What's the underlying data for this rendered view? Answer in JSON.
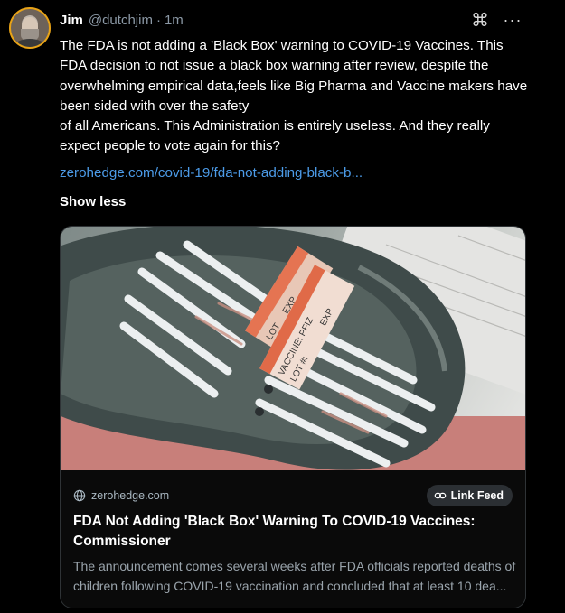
{
  "post": {
    "author_name": "Jim",
    "author_handle": "@dutchjim",
    "separator": "·",
    "time": "1m",
    "body_lines": [
      "The FDA is not adding a 'Black Box' warning to COVID-19 Vaccines. This FDA decision to not issue a black box warning after review, despite the overwhelming empirical data,feels like Big Pharma and Vaccine makers have been sided with over the safety",
      "of all Americans. This Administration is entirely useless. And they really expect people to vote again for this?"
    ],
    "link_text": "zerohedge.com/covid-19/fda-not-adding-black-b...",
    "show_less_label": "Show less"
  },
  "icons": {
    "command": "command-icon",
    "more": "more-options-icon",
    "globe": "globe-icon",
    "chain": "link-chain-icon"
  },
  "card": {
    "domain": "zerohedge.com",
    "feed_button_label": "Link Feed",
    "title": "FDA Not Adding 'Black Box' Warning To COVID-19 Vaccines: Commissioner",
    "description": "The announcement comes several weeks after FDA officials reported deaths of children following COVID-19 vaccination and concluded that at least 10 dea..."
  },
  "image_text": {
    "label_lot": "LOT",
    "label_exp": "EXP",
    "label_vaccine": "VACCINE: PFIZ",
    "label_lot2": "LOT #:",
    "label_exp2": "EXP"
  },
  "colors": {
    "background": "#000000",
    "link": "#4c9be8",
    "avatar_ring": "#e8a317",
    "card_border": "#2f3336",
    "button_bg": "#2b2f33"
  }
}
